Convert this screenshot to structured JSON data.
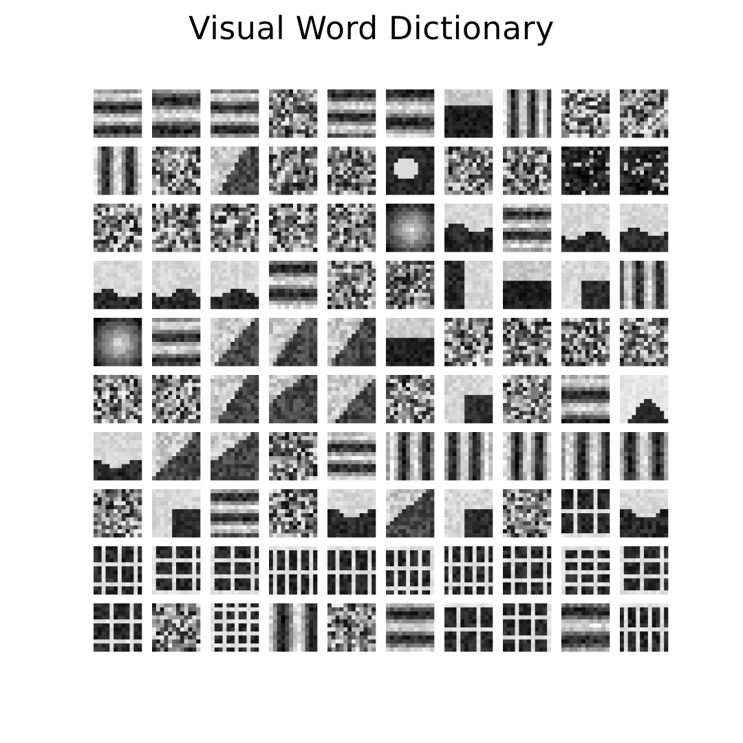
{
  "figure": {
    "title": "Visual Word Dictionary",
    "grid": {
      "rows": 10,
      "cols": 10,
      "patch_pixels": 12
    },
    "colormap": "grayscale",
    "patch_hints": [
      "hstripe",
      "hstripe",
      "hstripe",
      "noise",
      "hstripe",
      "hstripe",
      "darkband",
      "vstripe",
      "noise",
      "noise",
      "vstripe",
      "noise",
      "diagonal",
      "noise",
      "noise",
      "blob-dark",
      "noise",
      "noise",
      "dark",
      "dark",
      "noise",
      "noise",
      "noise",
      "noise",
      "noise",
      "blob-light",
      "horizon",
      "hstripe",
      "horizon",
      "horizon",
      "horizon",
      "horizon",
      "horizon",
      "hstripe",
      "noise",
      "noise",
      "vedge",
      "darkband",
      "corner",
      "vstripe",
      "blob-light",
      "hstripe",
      "diagonal",
      "diagonal",
      "diagonal",
      "darkband",
      "noise",
      "noise",
      "noise",
      "noise",
      "noise",
      "noise",
      "diagonal",
      "diagonal",
      "diagonal",
      "noise",
      "corner",
      "noise",
      "hstripe",
      "peak",
      "horizon",
      "diagonal",
      "diagonal",
      "noise",
      "hstripe",
      "vstripe",
      "vstripe",
      "vstripe",
      "vstripe",
      "vstripe",
      "noise",
      "corner",
      "hstripe",
      "noise",
      "horizon",
      "diagonal",
      "corner",
      "noise",
      "window",
      "horizon",
      "window",
      "window",
      "window",
      "window",
      "window",
      "window",
      "window",
      "window",
      "window",
      "window",
      "window",
      "noise",
      "window",
      "vstripe",
      "noise",
      "hstripe",
      "window",
      "window",
      "hstripe",
      "window"
    ]
  }
}
